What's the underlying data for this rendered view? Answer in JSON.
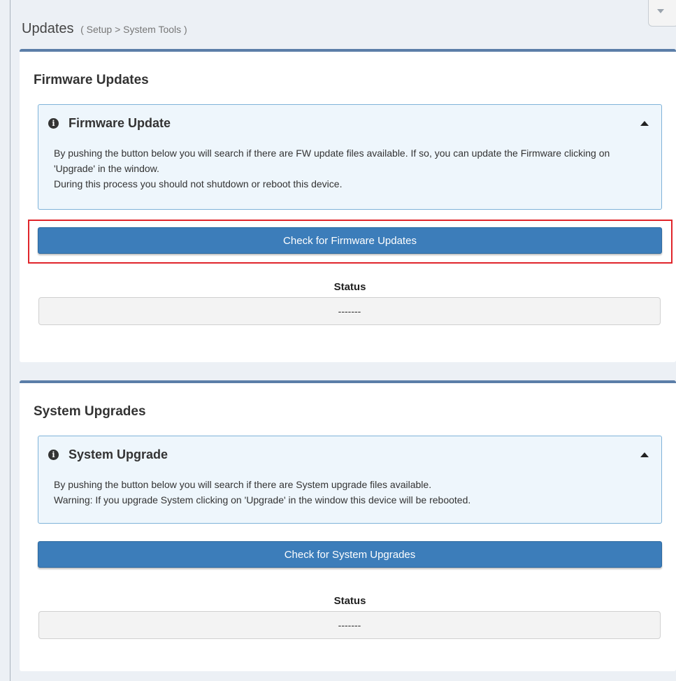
{
  "header": {
    "title": "Updates",
    "breadcrumb": "( Setup > System Tools )"
  },
  "firmware": {
    "section_title": "Firmware Updates",
    "callout_title": "Firmware Update",
    "lines": [
      "By pushing the button below you will search if there are FW update files available. If so, you can update the Firmware clicking on 'Upgrade' in the window.",
      "During this process you should not shutdown or reboot this device."
    ],
    "button_label": "Check for Firmware Updates",
    "status_label": "Status",
    "status_value": "-------"
  },
  "system": {
    "section_title": "System Upgrades",
    "callout_title": "System Upgrade",
    "lines": [
      "By pushing the button below you will search if there are System upgrade files available.",
      "Warning: If you upgrade System clicking on 'Upgrade' in the window this device will be rebooted."
    ],
    "button_label": "Check for System Upgrades",
    "status_label": "Status",
    "status_value": "-------"
  },
  "icons": {
    "info": "info-circle-icon",
    "collapse": "caret-up-icon",
    "dropdown": "caret-down-icon"
  },
  "colors": {
    "primary_button": "#3c7dba",
    "box_border": "#5b7ea8",
    "callout_border": "#7fb3d9",
    "callout_bg": "#eef6fc",
    "highlight": "#e0252b"
  }
}
